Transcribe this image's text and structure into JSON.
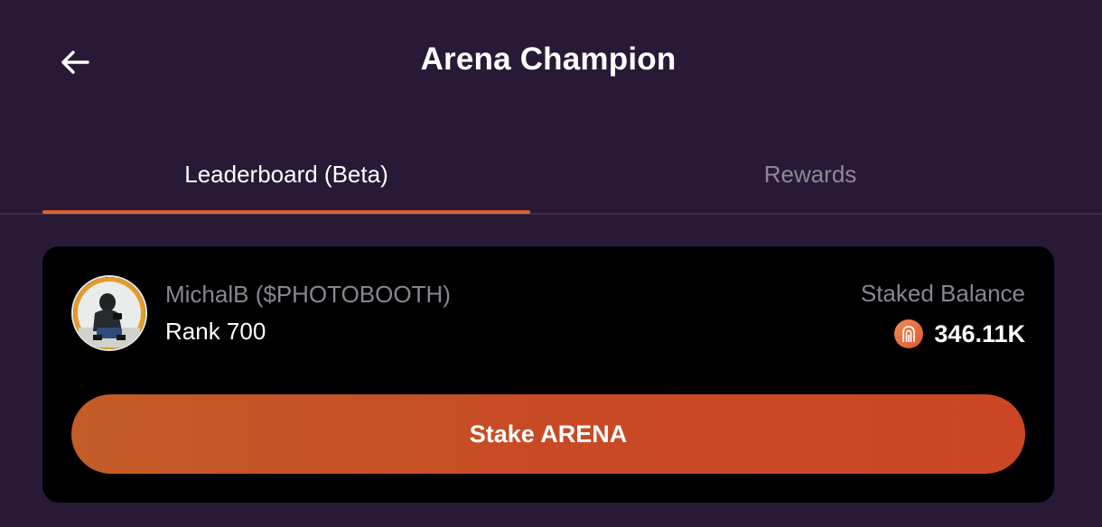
{
  "header": {
    "title": "Arena Champion",
    "back_icon": "arrow-left-icon"
  },
  "tabs": [
    {
      "label": "Leaderboard (Beta)",
      "active": true
    },
    {
      "label": "Rewards",
      "active": false
    }
  ],
  "user_card": {
    "name": "MichalB ($PHOTOBOOTH)",
    "rank": "Rank 700",
    "avatar_icon": "user-avatar",
    "staked_label": "Staked Balance",
    "staked_value": "346.11K",
    "token_icon": "arena-token-icon",
    "stake_button_label": "Stake ARENA"
  },
  "colors": {
    "background": "#281a36",
    "accent": "#e0622c",
    "card": "#000000",
    "muted_text": "#8a8590"
  }
}
